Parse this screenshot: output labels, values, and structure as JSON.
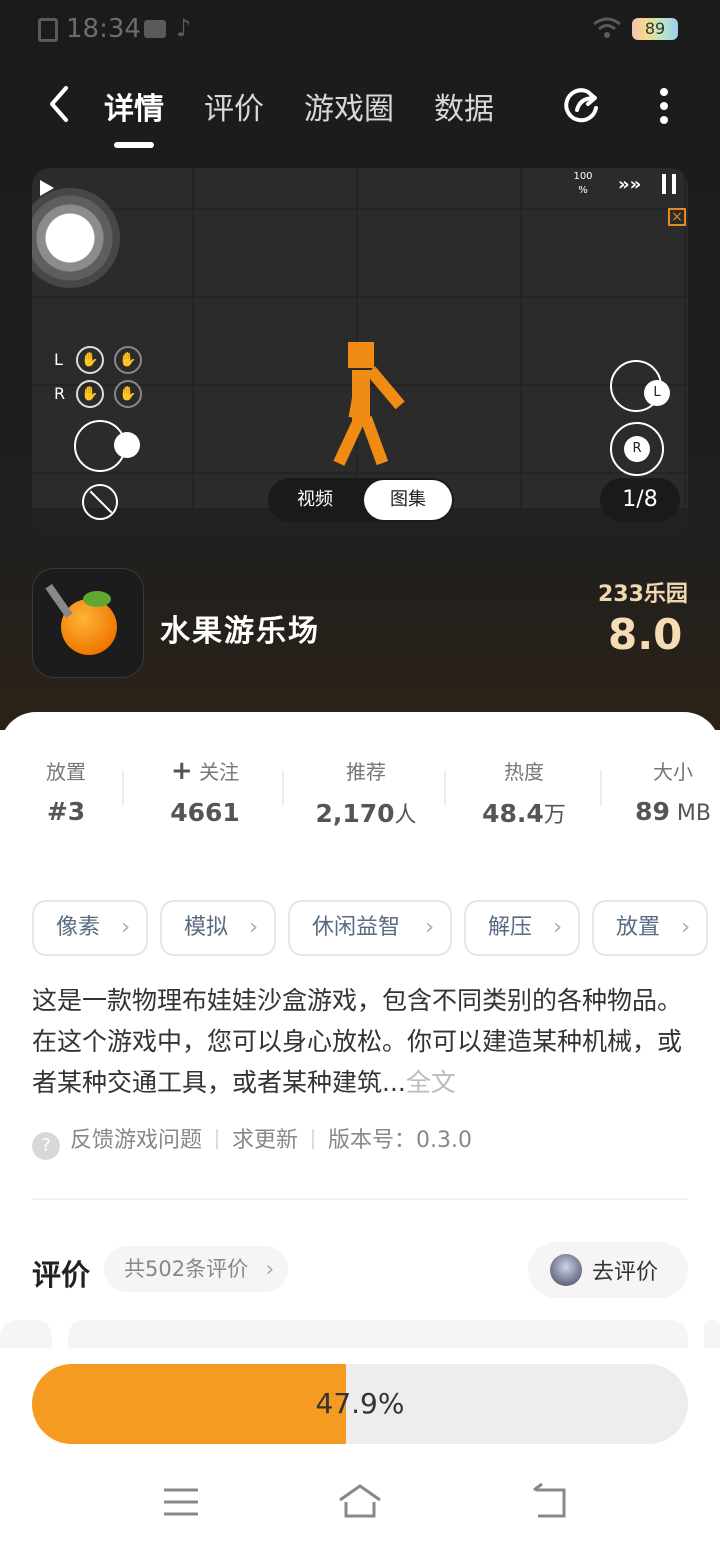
{
  "status_bar": {
    "time": "18:34",
    "battery": "89"
  },
  "nav": {
    "tabs": [
      "详情",
      "评价",
      "游戏圈",
      "数据"
    ],
    "active_tab": "详情"
  },
  "media": {
    "speed": "100\n%",
    "controls_left": [
      "L",
      "R"
    ],
    "stick_labels": [
      "L",
      "R"
    ],
    "segment_options": [
      "视频",
      "图集"
    ],
    "selected_segment": "图集",
    "pager": "1/8"
  },
  "game": {
    "name": "水果游乐场",
    "brand": "233乐园",
    "score": "8.0"
  },
  "stats": [
    {
      "label": "放置",
      "value": "#3"
    },
    {
      "label": "关注",
      "value": "4661",
      "prefix": "+"
    },
    {
      "label": "推荐",
      "value": "2,170",
      "unit": "人"
    },
    {
      "label": "热度",
      "value": "48.4",
      "unit": "万"
    },
    {
      "label": "大小",
      "value": "89",
      "unit": " MB"
    }
  ],
  "tags": [
    "像素",
    "模拟",
    "休闲益智",
    "解压",
    "放置"
  ],
  "description": {
    "text": "这是一款物理布娃娃沙盒游戏，包含不同类别的各种物品。在这个游戏中，您可以身心放松。你可以建造某种机械，或者某种交通工具，或者某种建筑...",
    "more": "全文"
  },
  "meta": {
    "feedback": "反馈游戏问题",
    "request_update": "求更新",
    "version": "版本号：0.3.0"
  },
  "reviews": {
    "title": "评价",
    "count": "共502条评价",
    "write": "去评价"
  },
  "download": {
    "progress_label": "47.9%",
    "progress": 0.479
  },
  "colors": {
    "accent": "#f59b22",
    "dark_bg": "#1b1b1b",
    "score": "#f6dcb5"
  }
}
